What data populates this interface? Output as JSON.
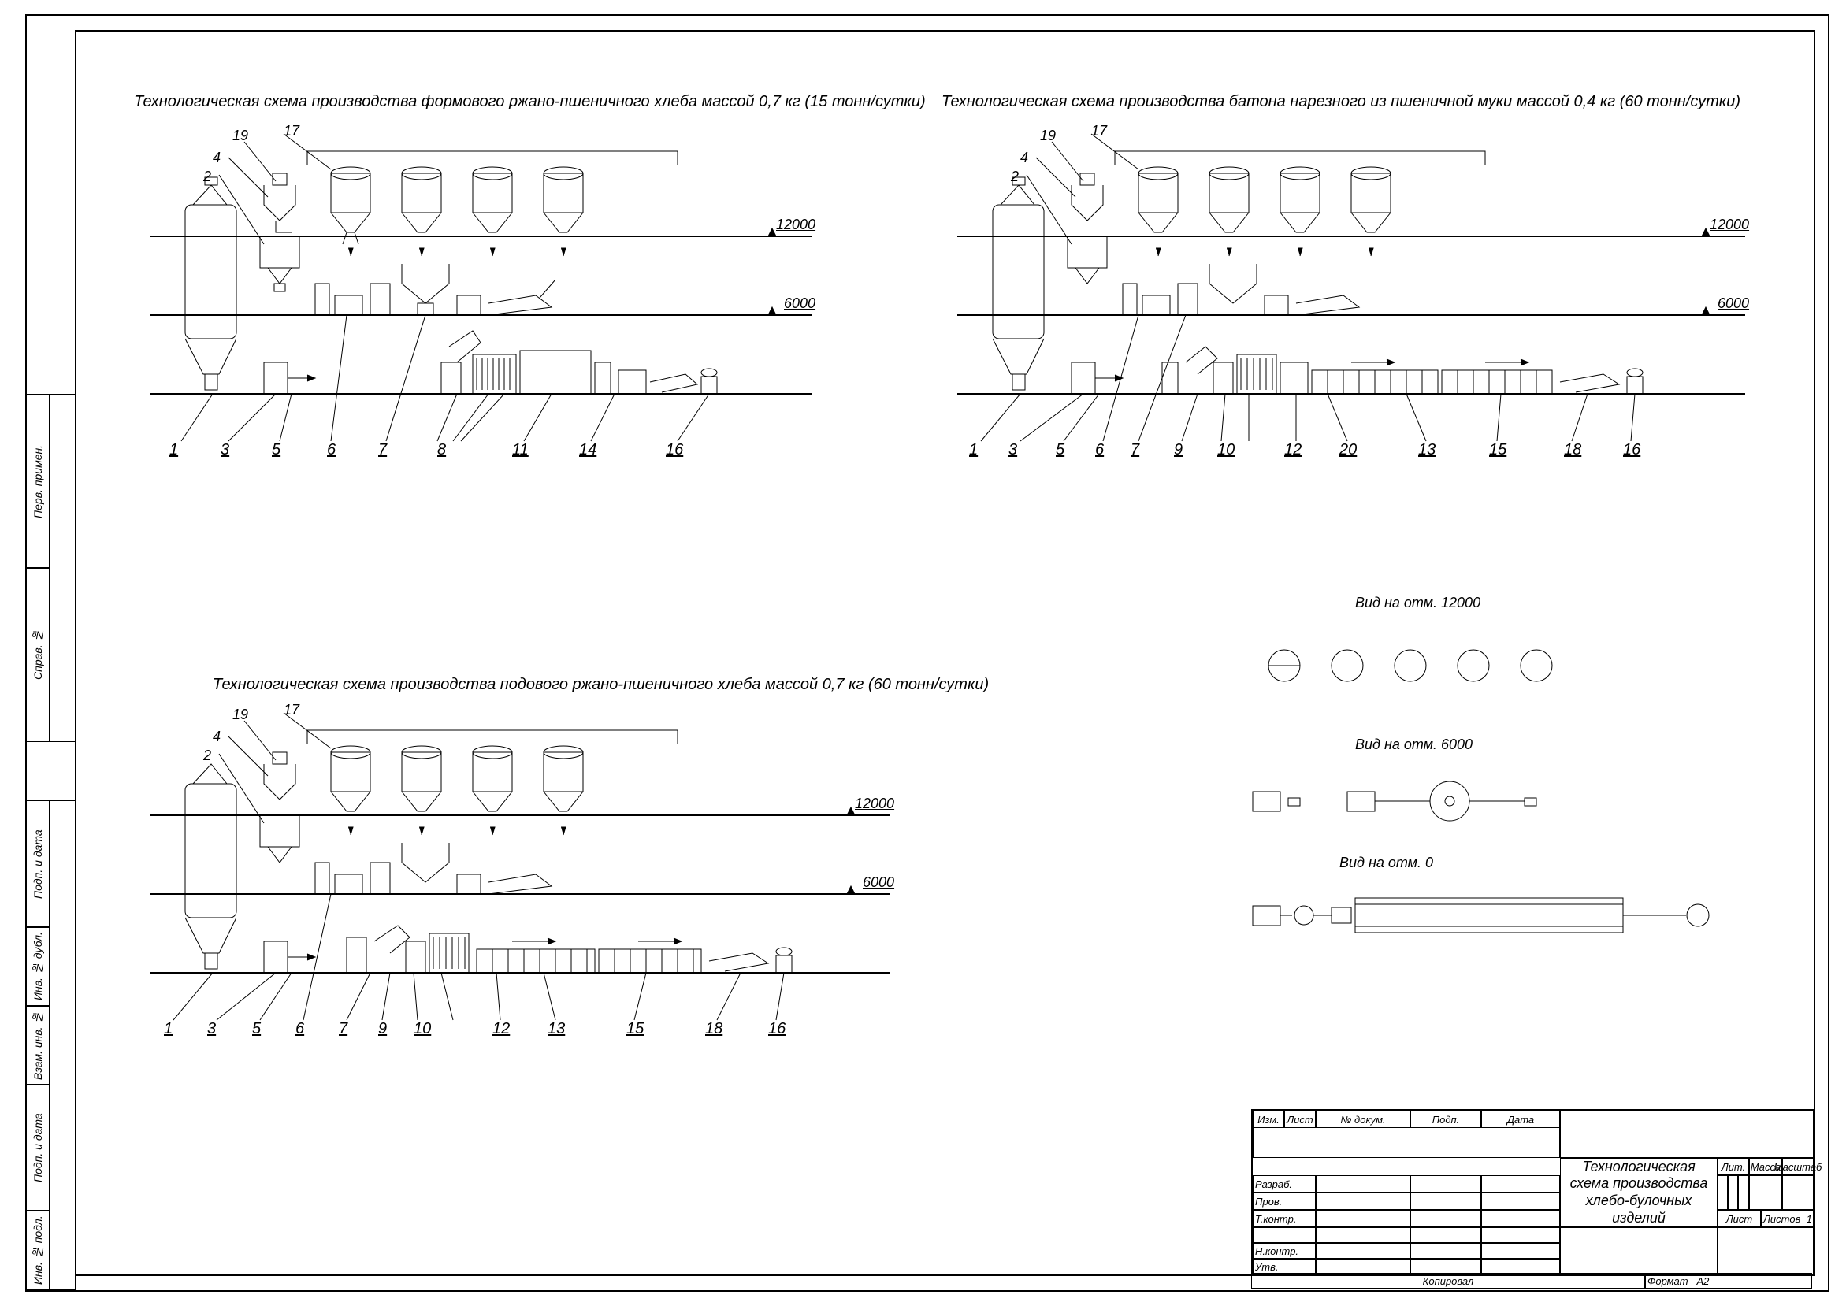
{
  "schematics": {
    "scheme1": {
      "title": "Технологическая схема производства формового ржано-пшеничного хлеба массой 0,7 кг (15 тонн/сутки)",
      "top_callouts": [
        "19",
        "17",
        "4",
        "2"
      ],
      "bottom_callouts": [
        "1",
        "3",
        "5",
        "6",
        "7",
        "8",
        "11",
        "14",
        "16"
      ],
      "elevations": [
        "12000",
        "6000"
      ]
    },
    "scheme2": {
      "title": "Технологическая схема производства батона нарезного из пшеничной муки массой 0,4 кг (60 тонн/сутки)",
      "top_callouts": [
        "19",
        "17",
        "4",
        "2"
      ],
      "bottom_callouts": [
        "1",
        "3",
        "5",
        "6",
        "7",
        "9",
        "10",
        "12",
        "20",
        "13",
        "15",
        "18",
        "16"
      ],
      "elevations": [
        "12000",
        "6000"
      ]
    },
    "scheme3": {
      "title": "Технологическая схема производства подового ржано-пшеничного хлеба массой 0,7 кг (60 тонн/сутки)",
      "top_callouts": [
        "19",
        "17",
        "4",
        "2"
      ],
      "bottom_callouts": [
        "1",
        "3",
        "5",
        "6",
        "7",
        "9",
        "10",
        "12",
        "13",
        "15",
        "18",
        "16"
      ],
      "elevations": [
        "12000",
        "6000"
      ]
    },
    "views": {
      "view1": "Вид на отм. 12000",
      "view2": "Вид на отм. 6000",
      "view3": "Вид на отм. 0"
    }
  },
  "side_tabs": {
    "t1": "Инв. № подл.",
    "t2": "Подп. и дата",
    "t3": "Взам. инв. №",
    "t4": "Инв. № дубл.",
    "t5": "Подп. и дата",
    "t6": "Справ. №",
    "t7": "Перв. примен."
  },
  "titleblock": {
    "main_title": "Технологическая схема производства хлебо-булочных изделий",
    "cols": {
      "izm": "Изм.",
      "list": "Лист",
      "ndoc": "№ докум.",
      "podp": "Подп.",
      "data": "Дата"
    },
    "rows": {
      "razrab": "Разраб.",
      "prov": "Пров.",
      "tkontr": "Т.контр.",
      "nkontr": "Н.контр.",
      "utv": "Утв."
    },
    "right": {
      "lit": "Лит.",
      "massa": "Масса",
      "mashtab": "Масштаб",
      "list_label": "Лист",
      "listov_label": "Листов",
      "listov_val": "1"
    },
    "footer": {
      "kopiroval": "Копировал",
      "format": "Формат",
      "format_val": "А2"
    }
  }
}
